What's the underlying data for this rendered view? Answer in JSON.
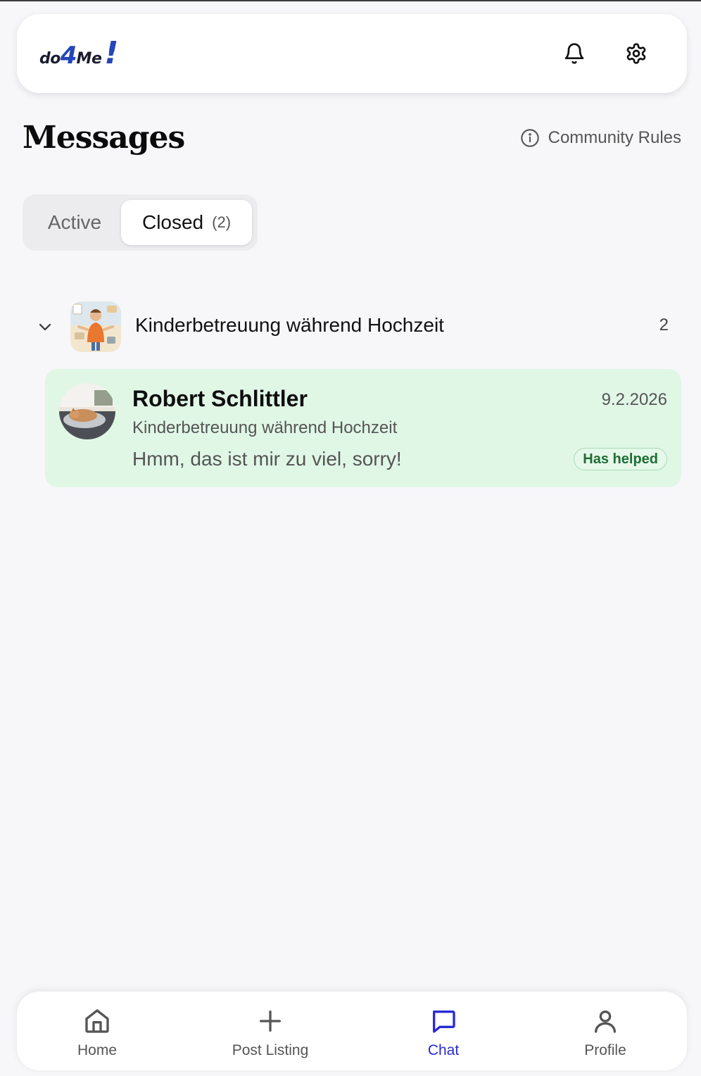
{
  "header": {
    "logo": {
      "part1": "do",
      "part2": "4",
      "part3": "Me",
      "part4": "!"
    },
    "icons": [
      "bell-icon",
      "gear-icon"
    ]
  },
  "page": {
    "title": "Messages",
    "rules_link": "Community Rules"
  },
  "tabs": {
    "active_label": "Active",
    "closed_label": "Closed",
    "closed_count": "(2)",
    "selected": "Closed"
  },
  "group": {
    "title": "Kinderbetreuung während Hochzeit",
    "count": "2",
    "expanded": true
  },
  "conversation": {
    "sender": "Robert Schlittler",
    "date": "9.2.2026",
    "subject": "Kinderbetreuung während Hochzeit",
    "preview": "Hmm, das ist mir zu viel, sorry!",
    "badge": "Has helped"
  },
  "nav": {
    "home": "Home",
    "post": "Post Listing",
    "chat": "Chat",
    "profile": "Profile",
    "current": "Chat"
  },
  "colors": {
    "accent": "#2a2ad6",
    "card_bg": "#e0f7e6",
    "badge_text": "#1f6d36",
    "logo_blue": "#2545b8"
  }
}
